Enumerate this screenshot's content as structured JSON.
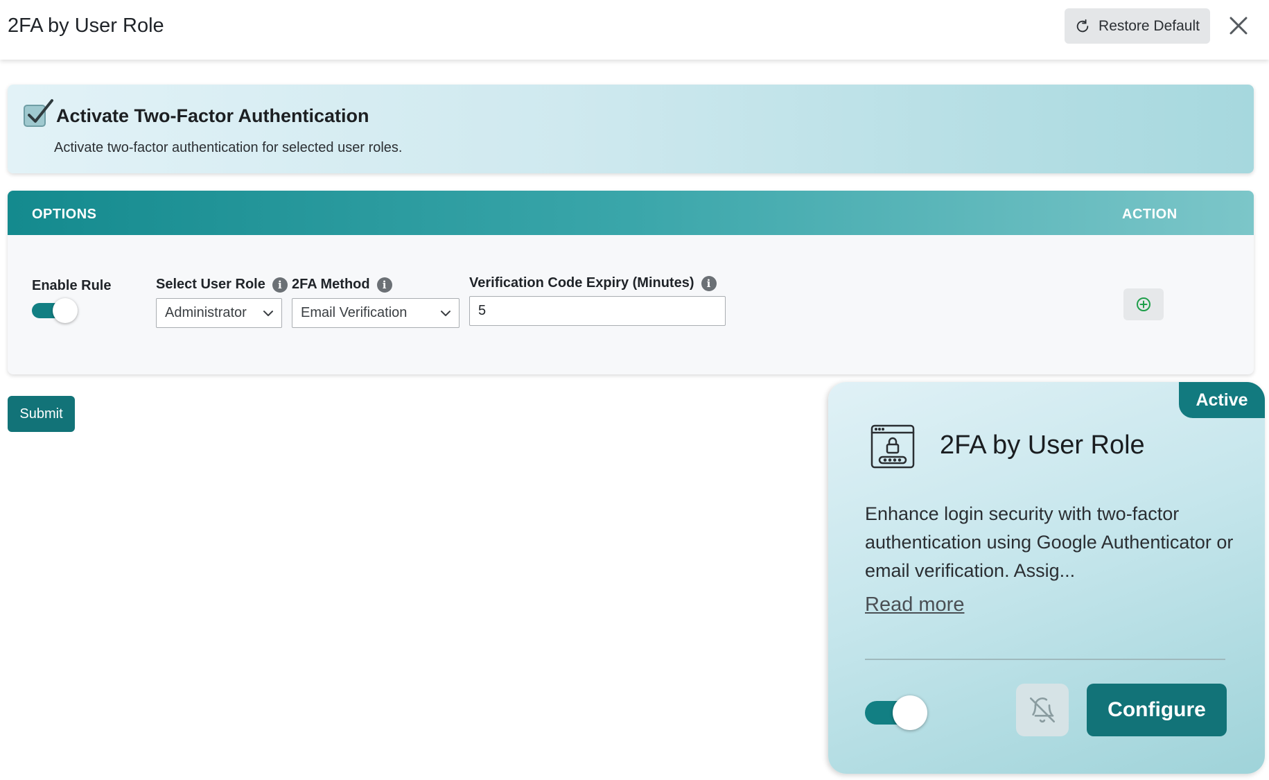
{
  "header": {
    "title": "2FA by User Role",
    "restore_label": "Restore Default"
  },
  "banner": {
    "title": "Activate Two-Factor Authentication",
    "description": "Activate two-factor authentication for selected user roles.",
    "checked": true
  },
  "options": {
    "col_options": "OPTIONS",
    "col_action": "ACTION",
    "enable_rule_label": "Enable Rule",
    "enable_rule_on": true,
    "user_role_label": "Select User Role",
    "user_role_value": "Administrator",
    "method_label": "2FA Method",
    "method_value": "Email Verification",
    "expiry_label": "Verification Code Expiry (Minutes)",
    "expiry_value": "5",
    "info_glyph": "i"
  },
  "submit_label": "Submit",
  "feature_card": {
    "badge": "Active",
    "title": "2FA by User Role",
    "description": "Enhance login security with two-factor authentication using Google Authenticator or email verification. Assig...",
    "read_more": "Read more",
    "toggle_on": true,
    "configure_label": "Configure"
  },
  "colors": {
    "primary": "#127378",
    "toggle": "#127f83",
    "header_gradient_start": "#148a8e",
    "add_icon": "#1e9e4a"
  },
  "icons": {
    "restore": "refresh-icon",
    "close": "close-icon",
    "check": "checkbox-icon",
    "info": "info-icon",
    "chevron": "chevron-down-icon",
    "add": "plus-circle-icon",
    "feature": "lock-window-icon",
    "bell": "bell-off-icon"
  }
}
